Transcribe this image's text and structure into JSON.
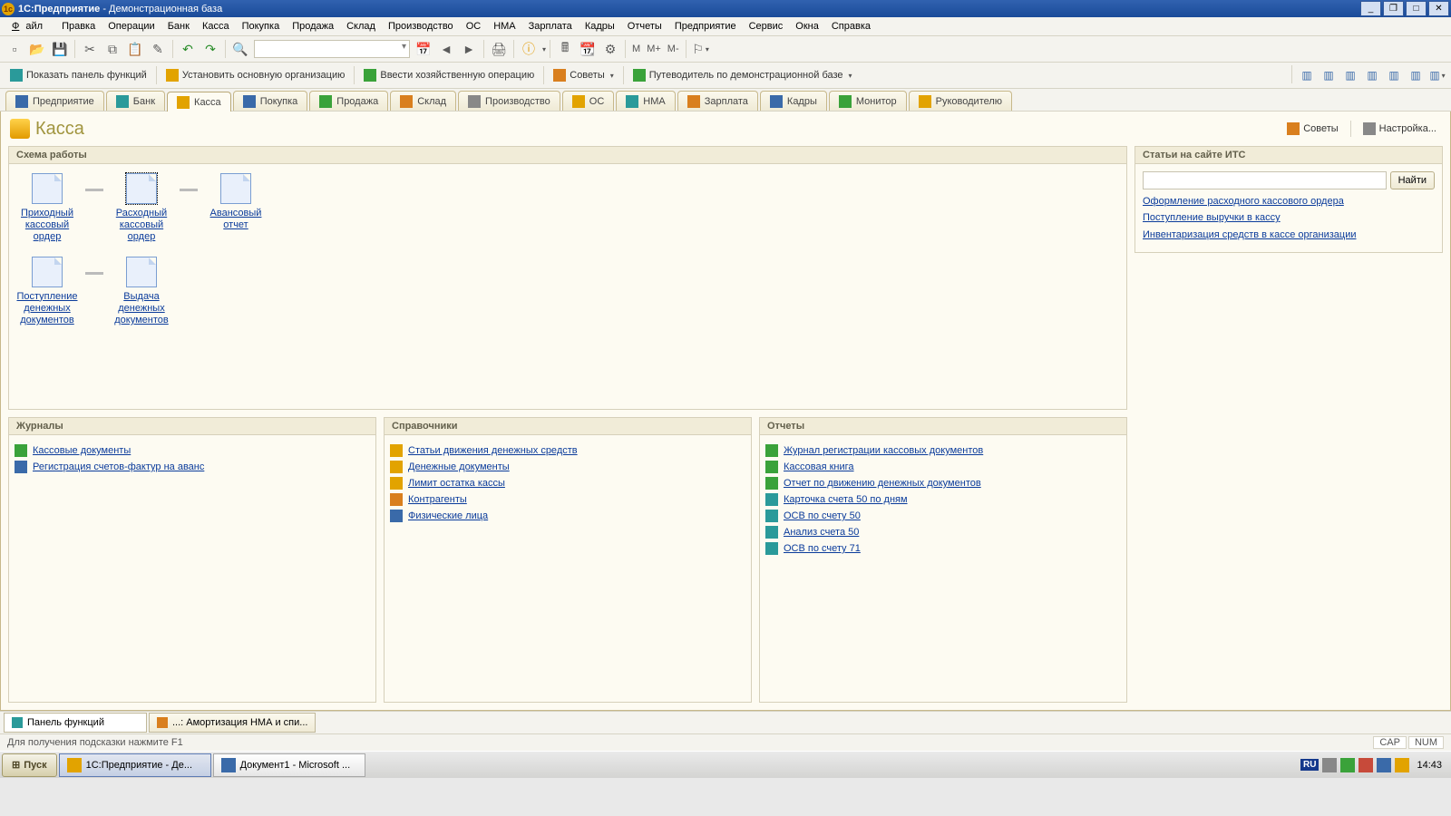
{
  "titlebar": {
    "app": "1С:Предприятие",
    "doc": "Демонстрационная база"
  },
  "menu": [
    "Файл",
    "Правка",
    "Операции",
    "Банк",
    "Касса",
    "Покупка",
    "Продажа",
    "Склад",
    "Производство",
    "ОС",
    "НМА",
    "Зарплата",
    "Кадры",
    "Отчеты",
    "Предприятие",
    "Сервис",
    "Окна",
    "Справка"
  ],
  "toolbar2": {
    "b1": "Показать панель функций",
    "b2": "Установить основную организацию",
    "b3": "Ввести хозяйственную операцию",
    "b4": "Советы",
    "b5": "Путеводитель по демонстрационной базе"
  },
  "tabs": [
    "Предприятие",
    "Банк",
    "Касса",
    "Покупка",
    "Продажа",
    "Склад",
    "Производство",
    "ОС",
    "НМА",
    "Зарплата",
    "Кадры",
    "Монитор",
    "Руководителю"
  ],
  "page": {
    "title": "Касса",
    "tips": "Советы",
    "settings": "Настройка..."
  },
  "schema": {
    "title": "Схема работы",
    "row1": [
      {
        "t": "Приходный кассовый ордер"
      },
      {
        "t": "Расходный кассовый ордер"
      },
      {
        "t": "Авансовый отчет"
      }
    ],
    "row2": [
      {
        "t": "Поступление денежных документов"
      },
      {
        "t": "Выдача денежных документов"
      }
    ]
  },
  "its": {
    "title": "Статьи на сайте ИТС",
    "find": "Найти",
    "links": [
      "Оформление расходного кассового ордера",
      "Поступление выручки в кассу",
      "Инвентаризация средств в кассе организации"
    ]
  },
  "cols": {
    "journals": {
      "title": "Журналы",
      "items": [
        "Кассовые документы",
        "Регистрация счетов-фактур на аванс"
      ]
    },
    "refs": {
      "title": "Справочники",
      "items": [
        "Статьи движения денежных средств",
        "Денежные документы",
        "Лимит остатка кассы",
        "Контрагенты",
        "Физические лица"
      ]
    },
    "reports": {
      "title": "Отчеты",
      "items": [
        "Журнал регистрации кассовых документов",
        "Кассовая книга",
        "Отчет по движению денежных документов",
        "Карточка счета 50 по дням",
        "ОСВ по счету 50",
        "Анализ счета 50",
        "ОСВ по счету 71"
      ]
    }
  },
  "wintabs": {
    "t1": "Панель функций",
    "t2": "...: Амортизация НМА и спи..."
  },
  "status": {
    "hint": "Для получения подсказки нажмите F1",
    "cap": "CAP",
    "num": "NUM"
  },
  "taskbar": {
    "start": "Пуск",
    "t1": "1С:Предприятие - Де...",
    "t2": "Документ1 - Microsoft ...",
    "lang": "RU",
    "time": "14:43"
  },
  "mbar": {
    "m": "M",
    "mp": "M+",
    "mm": "M-"
  }
}
